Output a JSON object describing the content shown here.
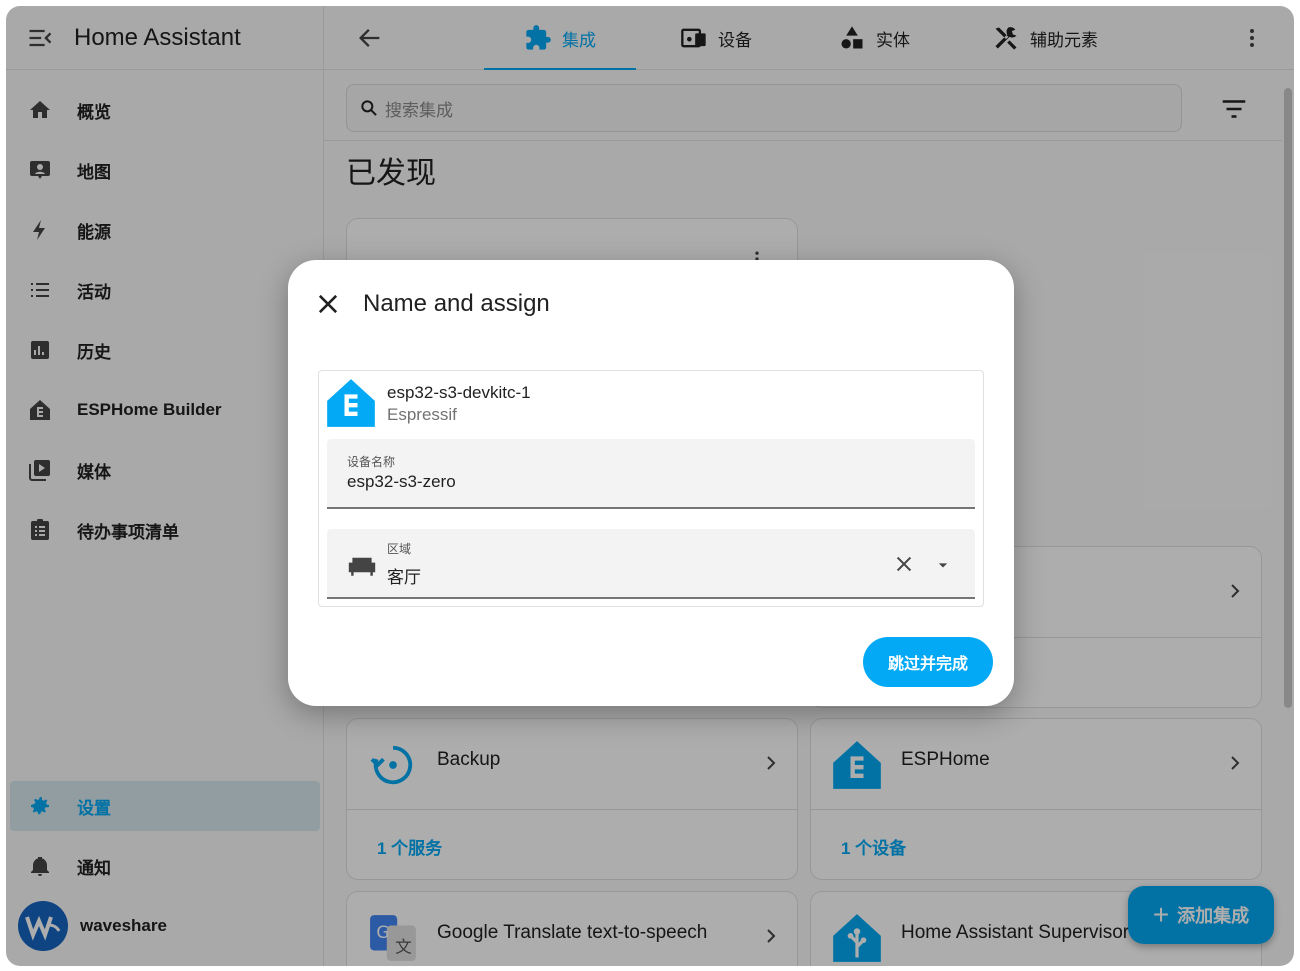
{
  "sidebar": {
    "title": "Home Assistant",
    "items": [
      {
        "label": "概览",
        "icon": "home-icon"
      },
      {
        "label": "地图",
        "icon": "map-icon"
      },
      {
        "label": "能源",
        "icon": "lightning-icon"
      },
      {
        "label": "活动",
        "icon": "list-icon"
      },
      {
        "label": "历史",
        "icon": "chart-icon"
      },
      {
        "label": "ESPHome Builder",
        "icon": "esphome-icon"
      },
      {
        "label": "媒体",
        "icon": "media-icon"
      },
      {
        "label": "待办事项清单",
        "icon": "clipboard-icon"
      }
    ],
    "settings_label": "设置",
    "notifications_label": "通知",
    "user_name": "waveshare"
  },
  "topbar": {
    "tabs": [
      {
        "label": "集成",
        "icon": "puzzle-icon",
        "active": true
      },
      {
        "label": "设备",
        "icon": "devices-icon",
        "active": false
      },
      {
        "label": "实体",
        "icon": "shapes-icon",
        "active": false
      },
      {
        "label": "辅助元素",
        "icon": "tools-icon",
        "active": false
      }
    ]
  },
  "search": {
    "placeholder": "搜索集成"
  },
  "main": {
    "section_title": "已发现",
    "cards": [
      {
        "title": "Backup",
        "footer": "1 个服务"
      },
      {
        "title": "ESPHome",
        "footer": "1 个设备"
      },
      {
        "title": "Google Translate text-to-speech"
      },
      {
        "title": "Home Assistant Supervisor"
      }
    ],
    "add_button_label": "添加集成"
  },
  "dialog": {
    "title": "Name and assign",
    "device_name": "esp32-s3-devkitc-1",
    "manufacturer": "Espressif",
    "name_field_label": "设备名称",
    "name_field_value": "esp32-s3-zero",
    "area_field_label": "区域",
    "area_field_value": "客厅",
    "primary_button": "跳过并完成"
  },
  "colors": {
    "accent": "#03a9f4",
    "active_bg": "#d6e7ee"
  }
}
